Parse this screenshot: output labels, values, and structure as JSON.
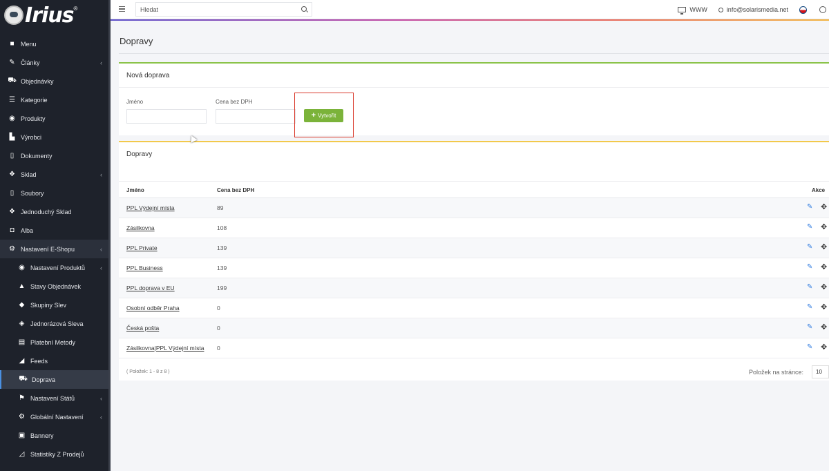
{
  "brand": {
    "name": "Irius",
    "reg": "®"
  },
  "sidebar": {
    "items": [
      {
        "label": "Menu",
        "icon": "folder-icon"
      },
      {
        "label": "Články",
        "icon": "pencil-icon",
        "chevron": "‹"
      },
      {
        "label": "Objednávky",
        "icon": "cart-icon"
      },
      {
        "label": "Kategorie",
        "icon": "list-icon"
      },
      {
        "label": "Produkty",
        "icon": "ball-icon"
      },
      {
        "label": "Výrobci",
        "icon": "building-icon"
      },
      {
        "label": "Dokumenty",
        "icon": "file-icon"
      },
      {
        "label": "Sklad",
        "icon": "dropbox-icon",
        "chevron": "‹"
      },
      {
        "label": "Soubory",
        "icon": "file-icon"
      },
      {
        "label": "Jednoduchý Sklad",
        "icon": "dropbox-icon"
      },
      {
        "label": "Alba",
        "icon": "camera-icon"
      },
      {
        "label": "Nastavení E-Shopu",
        "icon": "cogs-icon",
        "chevron": "‹"
      }
    ],
    "subitems": [
      {
        "label": "Nastavení Produktů",
        "icon": "ball-icon",
        "chevron": "‹"
      },
      {
        "label": "Stavy Objednávek",
        "icon": "bell-icon"
      },
      {
        "label": "Skupiny Slev",
        "icon": "tag-icon"
      },
      {
        "label": "Jednorázová Sleva",
        "icon": "tags-icon"
      },
      {
        "label": "Platební Metody",
        "icon": "card-icon"
      },
      {
        "label": "Feeds",
        "icon": "rss-icon"
      },
      {
        "label": "Doprava",
        "icon": "truck-icon"
      },
      {
        "label": "Nastavení Států",
        "icon": "flag-icon",
        "chevron": "‹"
      },
      {
        "label": "Globální Nastavení",
        "icon": "gear-icon",
        "chevron": "‹"
      },
      {
        "label": "Bannery",
        "icon": "image-icon"
      },
      {
        "label": "Statistiky Z Prodejů",
        "icon": "chart-icon"
      }
    ]
  },
  "topbar": {
    "search_placeholder": "Hledat",
    "www_label": "WWW",
    "user_email": "info@solarismedia.net"
  },
  "page": {
    "title": "Dopravy"
  },
  "new_form": {
    "title": "Nová doprava",
    "name_label": "Jméno",
    "price_label": "Cena bez DPH",
    "name_value": "",
    "price_value": "",
    "create_label": "Vytvořit",
    "accent": "#7bb33a"
  },
  "list": {
    "title": "Dopravy",
    "headers": {
      "name": "Jméno",
      "price": "Cena bez DPH",
      "actions": "Akce"
    },
    "rows": [
      {
        "name": "PPL Výdejní místa",
        "price": "89"
      },
      {
        "name": "Zásilkovna",
        "price": "108"
      },
      {
        "name": "PPL Private",
        "price": "139"
      },
      {
        "name": "PPL Business",
        "price": "139"
      },
      {
        "name": "PPL doprava v EU",
        "price": "199"
      },
      {
        "name": "Osobní odběr Praha",
        "price": "0"
      },
      {
        "name": "Česká pošta",
        "price": "0"
      },
      {
        "name": "Zásilkovna|PPL Výdejní místa",
        "price": "0"
      }
    ],
    "count_text": "( Položek: 1 - 8 z 8 )",
    "per_page_label": "Položek na stránce:",
    "per_page_value": "10"
  }
}
